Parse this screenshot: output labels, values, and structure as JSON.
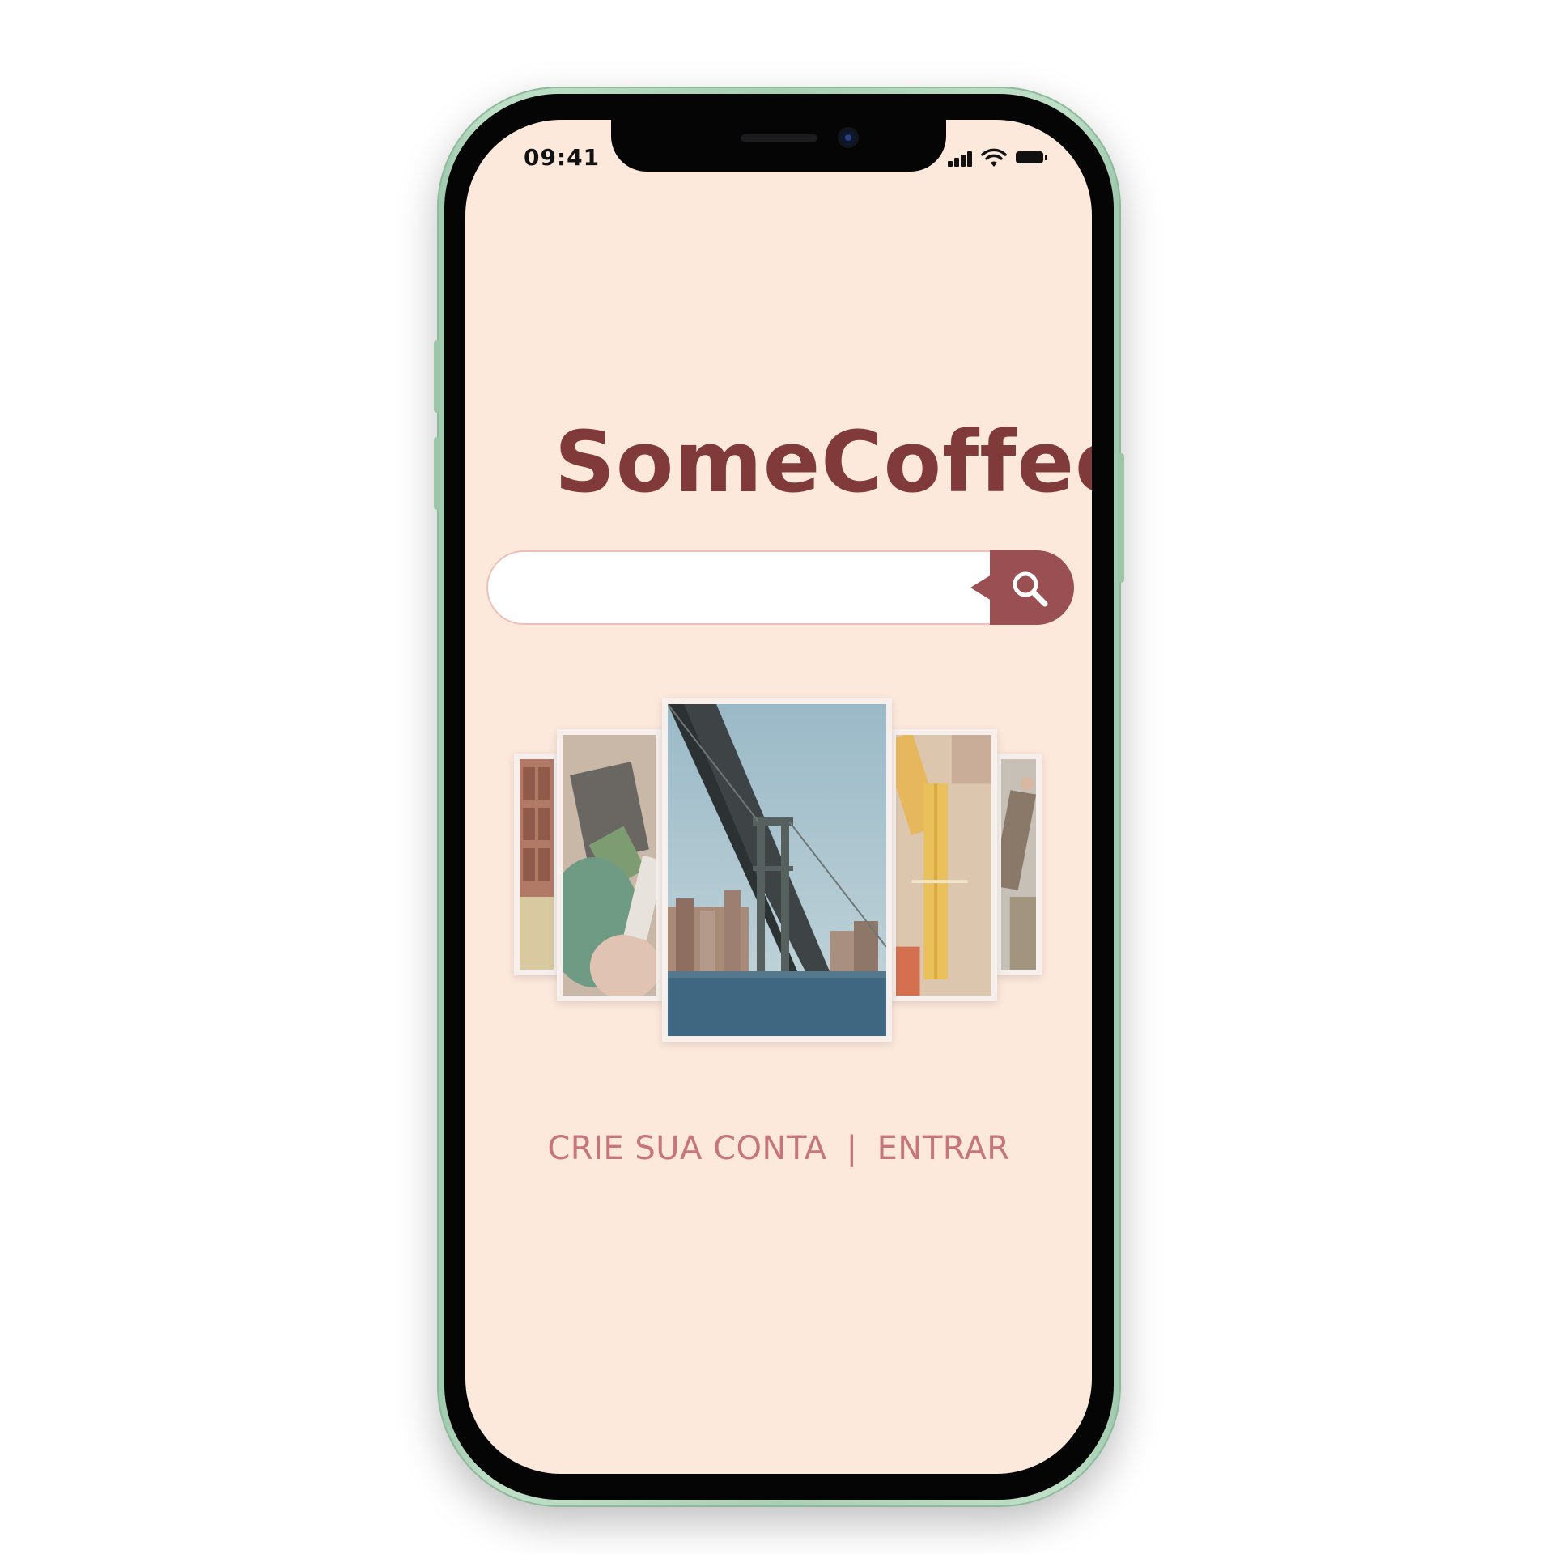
{
  "status_bar": {
    "time": "09:41"
  },
  "app": {
    "logo_text": "SomeCoffee",
    "brand_color": "#803a3a",
    "background_color": "#fde8dc"
  },
  "search": {
    "value": "",
    "placeholder": "",
    "button_icon": "search-icon",
    "button_color": "#9a4f52"
  },
  "carousel": {
    "cards": [
      {
        "name": "photo-card-far-left",
        "subject": "window-facade"
      },
      {
        "name": "photo-card-left",
        "subject": "hands-with-notes"
      },
      {
        "name": "photo-card-center",
        "subject": "bridge-over-river"
      },
      {
        "name": "photo-card-right",
        "subject": "tied-spaghetti"
      },
      {
        "name": "photo-card-far-right",
        "subject": "workshop"
      }
    ]
  },
  "auth": {
    "signup_label": "CRIE SUA CONTA",
    "divider": "|",
    "login_label": "ENTRAR",
    "link_color": "#c4767a"
  }
}
